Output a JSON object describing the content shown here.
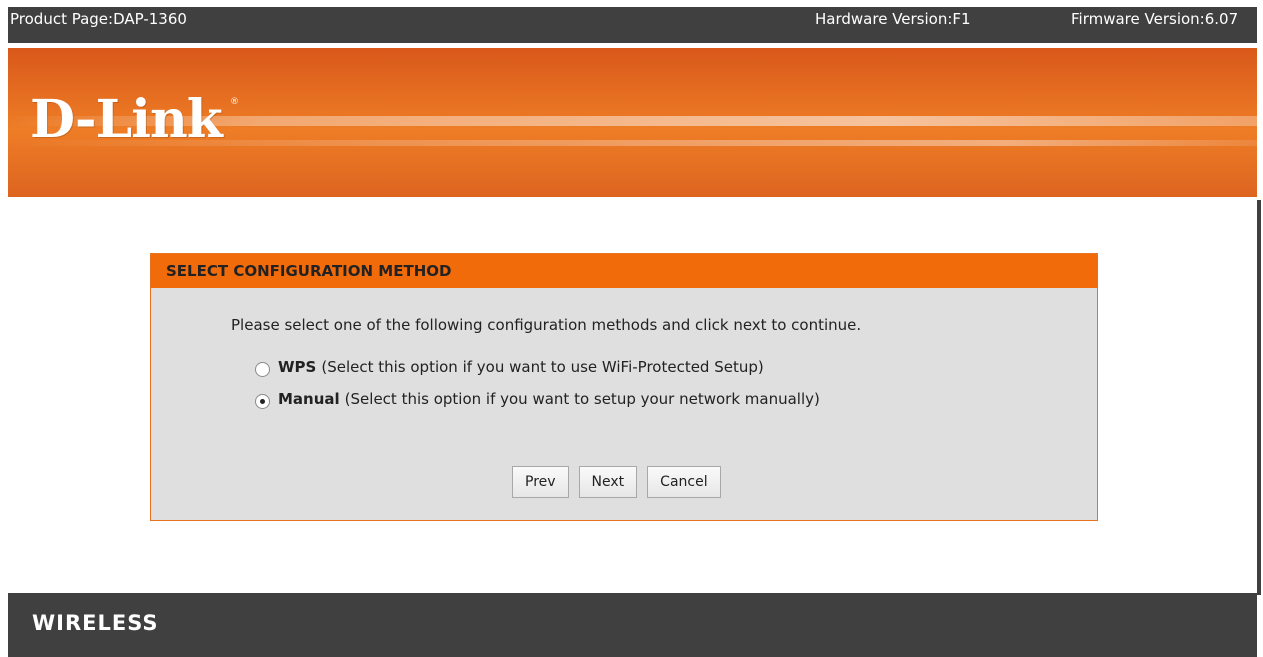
{
  "topbar": {
    "product_page": "Product Page:DAP-1360",
    "hardware_version": "Hardware Version:F1",
    "firmware_version": "Firmware Version:6.07"
  },
  "banner": {
    "logo_text": "D-Link",
    "registered_mark": "®"
  },
  "panel": {
    "title": "SELECT CONFIGURATION METHOD",
    "instruction": "Please select one of the following configuration methods and click next to continue.",
    "options": [
      {
        "name": "WPS",
        "description": "(Select this option if you want to use WiFi-Protected Setup)",
        "checked": false
      },
      {
        "name": "Manual",
        "description": "(Select this option if you want to setup your network manually)",
        "checked": true
      }
    ],
    "buttons": {
      "prev": "Prev",
      "next": "Next",
      "cancel": "Cancel"
    }
  },
  "footer": {
    "label": "WIRELESS"
  },
  "colors": {
    "accent_orange": "#f26b0a",
    "dark_bar": "#404040",
    "panel_bg": "#dfdfdf"
  }
}
